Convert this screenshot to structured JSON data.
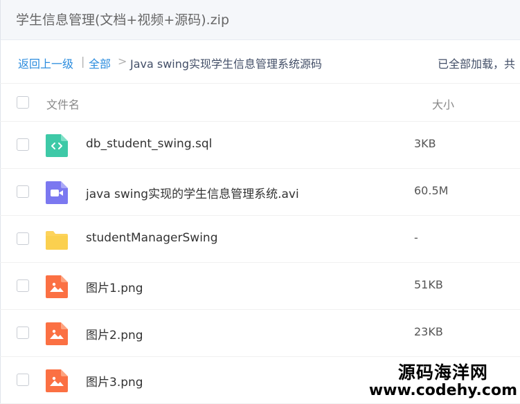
{
  "window": {
    "title": "学生信息管理(文档+视频+源码).zip"
  },
  "breadcrumb": {
    "back_label": "返回上一级",
    "divider": "|",
    "all_label": "全部",
    "arrow": ">",
    "current": "Java swing实现学生信息管理系统源码",
    "status": "已全部加载，共"
  },
  "table": {
    "col_name": "文件名",
    "col_size": "大小",
    "rows": [
      {
        "name": "db_student_swing.sql",
        "size": "3KB",
        "icon": "sql-file-icon"
      },
      {
        "name": "java swing实现的学生信息管理系统.avi",
        "size": "60.5M",
        "icon": "video-file-icon"
      },
      {
        "name": "studentManagerSwing",
        "size": "-",
        "icon": "folder-icon"
      },
      {
        "name": "图片1.png",
        "size": "51KB",
        "icon": "image-file-icon"
      },
      {
        "name": "图片2.png",
        "size": "23KB",
        "icon": "image-file-icon"
      },
      {
        "name": "图片3.png",
        "size": "",
        "icon": "image-file-icon"
      }
    ]
  },
  "watermark": {
    "line1": "源码海洋网",
    "line2": "www.codehy.com"
  },
  "colors": {
    "link": "#2b8cde",
    "sql": "#3ec9a7",
    "video": "#7b78f0",
    "folder": "#fdd35b",
    "image": "#fb7043"
  }
}
